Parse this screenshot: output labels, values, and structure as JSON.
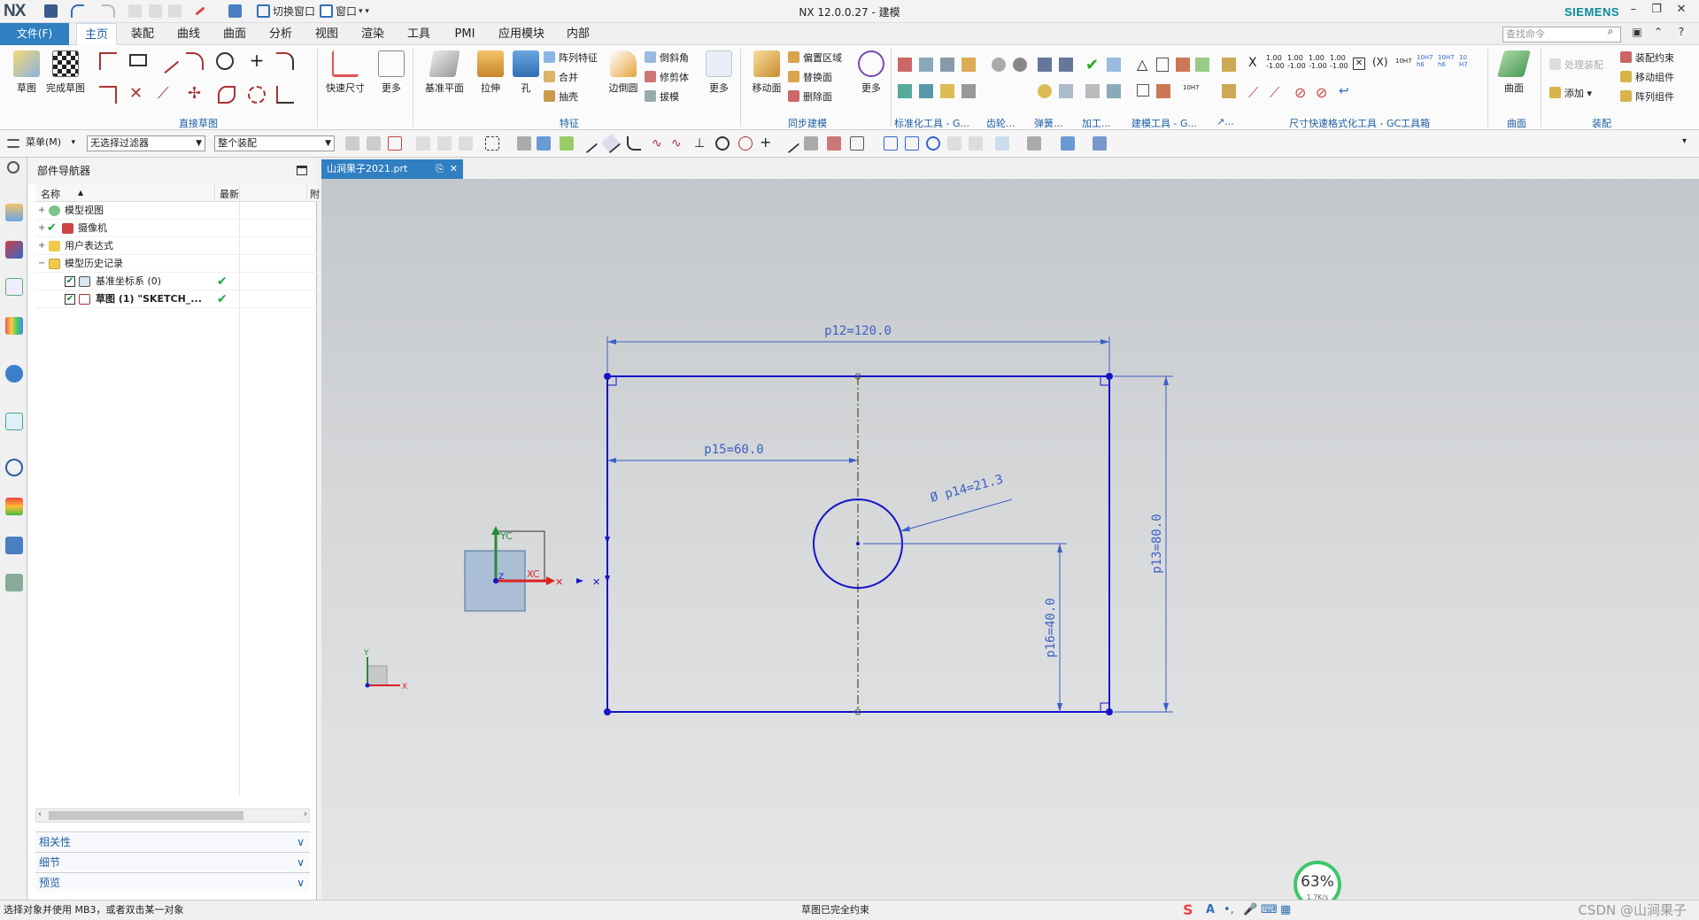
{
  "app": {
    "logo": "NX",
    "title": "NX 12.0.0.27 - 建模",
    "brand": "SIEMENS",
    "quick_access": {
      "switch_window": "切换窗口",
      "window": "窗口"
    }
  },
  "menu": {
    "file": "文件(F)",
    "tabs": [
      "主页",
      "装配",
      "曲线",
      "曲面",
      "分析",
      "视图",
      "渲染",
      "工具",
      "PMI",
      "应用模块",
      "内部"
    ],
    "active_tab": "主页",
    "search_placeholder": "查找命令"
  },
  "ribbon": {
    "direct_sketch": {
      "label": "直接草图",
      "buttons": {
        "sketch": "草图",
        "finish_sketch": "完成草图"
      }
    },
    "feature": {
      "label": "特征",
      "buttons": {
        "quick_dimension": "快速尺寸",
        "more1": "更多",
        "datum_plane": "基准平面",
        "extrude": "拉伸",
        "hole": "孔",
        "pattern_feature": "阵列特征",
        "unite": "合并",
        "shell": "抽壳",
        "edge_blend": "边倒圆",
        "chamfer": "倒斜角",
        "trim_body": "修剪体",
        "draft": "拔模",
        "more2": "更多"
      }
    },
    "sync_modeling": {
      "label": "同步建模",
      "buttons": {
        "move_face": "移动面",
        "offset_region": "偏置区域",
        "replace_face": "替换面",
        "delete_face": "删除面",
        "more": "更多"
      }
    },
    "groups": {
      "standard_tools": "标准化工具 - G...",
      "gear": "齿轮...",
      "spring": "弹簧...",
      "machining": "加工...",
      "modeling_tools": "建模工具 - G...",
      "more_group": "↗...",
      "dim_tools": "尺寸快速格式化工具 - GC工具箱"
    },
    "surface": {
      "label": "曲面",
      "button": "曲面"
    },
    "assembly": {
      "label": "装配",
      "buttons": {
        "process_assembly": "处理装配",
        "add": "添加",
        "assembly_constraints": "装配约束",
        "move_component": "移动组件",
        "pattern_component": "阵列组件"
      }
    }
  },
  "selection_bar": {
    "menu": "菜单(M)",
    "filter": "无选择过滤器",
    "scope": "整个装配"
  },
  "navigator": {
    "title": "部件导航器",
    "columns": {
      "name": "名称",
      "latest": "最新",
      "extra": "附"
    },
    "nodes": [
      {
        "label": "模型视图",
        "icon": "model-views-icon"
      },
      {
        "label": "摄像机",
        "icon": "camera-icon"
      },
      {
        "label": "用户表达式",
        "icon": "folder-icon"
      },
      {
        "label": "模型历史记录",
        "icon": "open-folder-icon"
      },
      {
        "label": "基准坐标系 (0)",
        "icon": "datum-csys-icon",
        "latest": "✔"
      },
      {
        "label": "草图 (1) \"SKETCH_...",
        "icon": "sketch-icon",
        "latest": "✔"
      }
    ],
    "panels": [
      "相关性",
      "细节",
      "预览"
    ]
  },
  "document": {
    "tab": "山涧果子2021.prt"
  },
  "sketch": {
    "dimensions": {
      "width": "p12=120.0",
      "height": "p13=80.0",
      "diameter": "Ø p14=21.3",
      "hole_y": "p16=40.0",
      "hole_x": "p15=60.0"
    },
    "axes": {
      "yc": "YC",
      "xc": "XC",
      "z": "Z"
    },
    "view_triad": {
      "x": "X",
      "y": "Y"
    }
  },
  "speed_widget": {
    "percent": "63%",
    "rate": "1.7K/s"
  },
  "status": {
    "left": "选择对象并使用 MB3，或者双击某一对象",
    "middle": "草图已完全约束"
  },
  "watermark": "CSDN @山涧果子",
  "colors": {
    "accent": "#2f7fc1",
    "sketch_line": "#1414c8",
    "dimension": "#3b5fc6",
    "check": "#22a63a"
  }
}
